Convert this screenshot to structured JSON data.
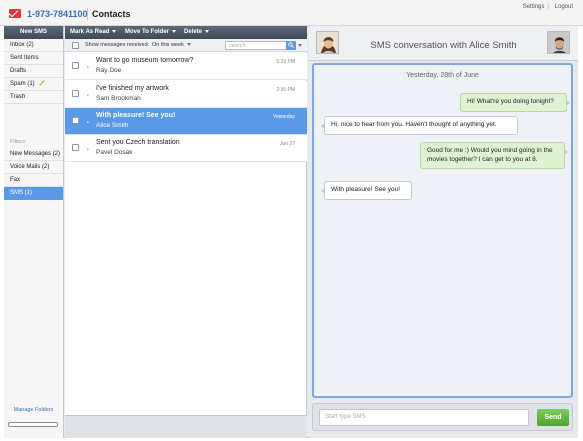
{
  "header": {
    "phone": "1-973-7841100",
    "section": "Contacts",
    "links": [
      "Settings",
      "Logout"
    ]
  },
  "sidebar": {
    "new_button": "New SMS",
    "folders": [
      {
        "label": "Inbox (2)"
      },
      {
        "label": "Sent Items"
      },
      {
        "label": "Drafts"
      },
      {
        "label": "Spam (1)"
      },
      {
        "label": "Trash"
      }
    ],
    "filters_label": "Filters:",
    "filters": [
      {
        "label": "New Messages (2)"
      },
      {
        "label": "Voice Mails (2)"
      },
      {
        "label": "Fax"
      },
      {
        "label": "SMS (1)"
      }
    ],
    "manage_link": "Manage Folders"
  },
  "toolbar": {
    "mark_as_read": "Mark As Read",
    "move_to_folder": "Move To Folder",
    "delete": "Delete"
  },
  "filterbar": {
    "label": "Show messages received:",
    "selected": "On this week",
    "search_placeholder": "search"
  },
  "messages": [
    {
      "subject": "Want to go museum tomorrow?",
      "sender": "Ray Doe",
      "date": "5:29 PM"
    },
    {
      "subject": "I've finished my artwork",
      "sender": "Sam Brookman",
      "date": "2:36 PM"
    },
    {
      "subject": "With pleasure! See you!",
      "sender": "Alice Smith",
      "date": "Yesterday"
    },
    {
      "subject": "Sent you Czech translation",
      "sender": "Pavel Dosak",
      "date": "Jun 27"
    }
  ],
  "conversation": {
    "title": "SMS conversation with Alice Smith",
    "day": "Yesterday, 28th of June",
    "bubbles": [
      {
        "from": "me",
        "text": "Hi! What're you doing tonight?"
      },
      {
        "from": "them",
        "text": "Hi, nice to hear from you. Haven't thought of anything yet."
      },
      {
        "from": "me",
        "text": "Good for me :) Would you mind going in the movies together? I can get to you at 8."
      },
      {
        "from": "them",
        "text": "With pleasure! See you!"
      }
    ],
    "compose_placeholder": "Start type SMS",
    "send_label": "Send"
  },
  "colors": {
    "accent": "#5a99e6",
    "toolbar": "#4a5565",
    "send": "#5fb542",
    "brand_red": "#d83c3c",
    "phone_blue": "#3a6fb0"
  }
}
